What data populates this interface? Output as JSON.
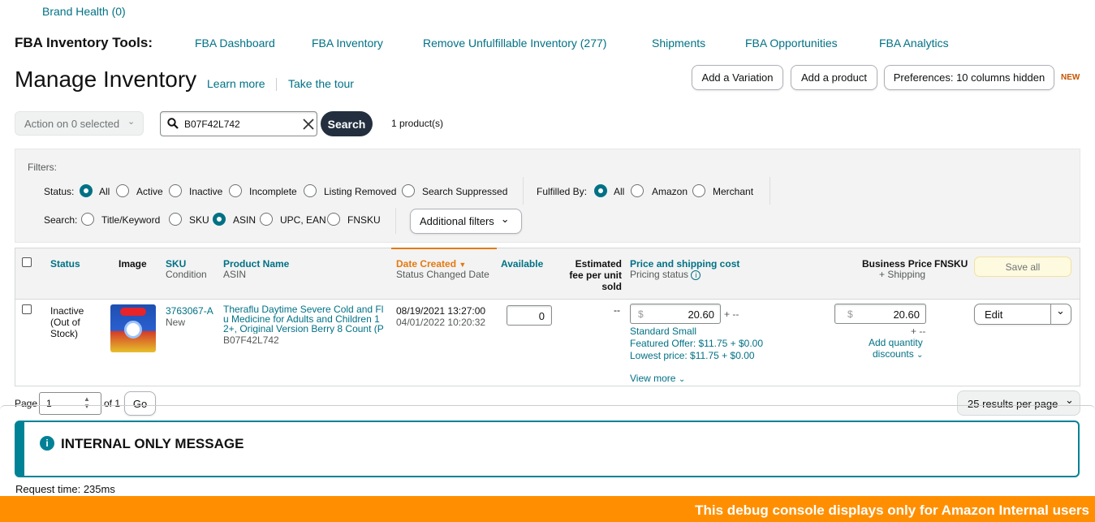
{
  "brand_health": "Brand Health (0)",
  "tools": {
    "label": "FBA Inventory Tools:",
    "links": [
      "FBA Dashboard",
      "FBA Inventory",
      "Remove Unfulfillable Inventory (277)",
      "Shipments",
      "FBA Opportunities",
      "FBA Analytics"
    ]
  },
  "page": {
    "title": "Manage Inventory",
    "learn_more": "Learn more",
    "take_tour": "Take the tour",
    "add_variation": "Add a Variation",
    "add_product": "Add a product",
    "preferences": "Preferences: 10 columns hidden",
    "new_badge": "NEW"
  },
  "toolbar": {
    "action": "Action on 0 selected",
    "search_value": "B07F42L742",
    "search_button": "Search",
    "count": "1 product(s)"
  },
  "filters": {
    "label": "Filters:",
    "status_label": "Status:",
    "status_options": [
      "All",
      "Active",
      "Inactive",
      "Incomplete",
      "Listing Removed",
      "Search Suppressed"
    ],
    "fulfilled_label": "Fulfilled By:",
    "fulfilled_options": [
      "All",
      "Amazon",
      "Merchant"
    ],
    "search_label": "Search:",
    "search_options": [
      "Title/Keyword",
      "SKU",
      "ASIN",
      "UPC, EAN",
      "FNSKU"
    ],
    "additional": "Additional filters"
  },
  "table": {
    "status": "Status",
    "image": "Image",
    "sku": "SKU",
    "condition": "Condition",
    "product_name": "Product Name",
    "asin": "ASIN",
    "date_created": "Date Created",
    "status_changed": "Status Changed Date",
    "available": "Available",
    "fee_1": "Estimated",
    "fee_2": "fee per unit",
    "fee_3": "sold",
    "price": "Price and shipping cost",
    "pricing_status": "Pricing status",
    "business_price": "Business Price",
    "plus_shipping": "+ Shipping",
    "fnsku": "FNSKU",
    "save_all": "Save all"
  },
  "row": {
    "status_1": "Inactive",
    "status_2": "(Out of",
    "status_3": "Stock)",
    "sku": "3763067-A",
    "condition": "New",
    "name_1": "Theraflu Daytime Severe Cold and Fl",
    "name_2": "u Medicine for Adults and Children 1",
    "name_3": "2+, Original Version Berry 8 Count (P",
    "asin": "B07F42L742",
    "date_created": "08/19/2021 13:27:00",
    "status_changed": "04/01/2022 10:20:32",
    "available": "0",
    "fee": "--",
    "currency": "$",
    "price": "20.60",
    "plus_dash": "+ --",
    "size": "Standard Small",
    "featured_offer": "Featured Offer: $11.75 + $0.00",
    "lowest_price": "Lowest price: $11.75 + $0.00",
    "view_more": "View more",
    "business_price": "20.60",
    "add_quantity_1": "Add quantity",
    "add_quantity_2": "discounts",
    "edit": "Edit"
  },
  "pagination": {
    "page_label": "Page",
    "page_value": "1",
    "of": "of 1",
    "go": "Go",
    "per_page": "25 results per page"
  },
  "internal": {
    "title": "INTERNAL ONLY MESSAGE",
    "request_time": "Request time: 235ms",
    "debug": "This debug console displays only for Amazon Internal users"
  },
  "colors": {
    "link": "#007185",
    "accent_orange": "#c45500",
    "debug_bar": "#ff8f00",
    "save_all_bg": "#fefae0"
  }
}
